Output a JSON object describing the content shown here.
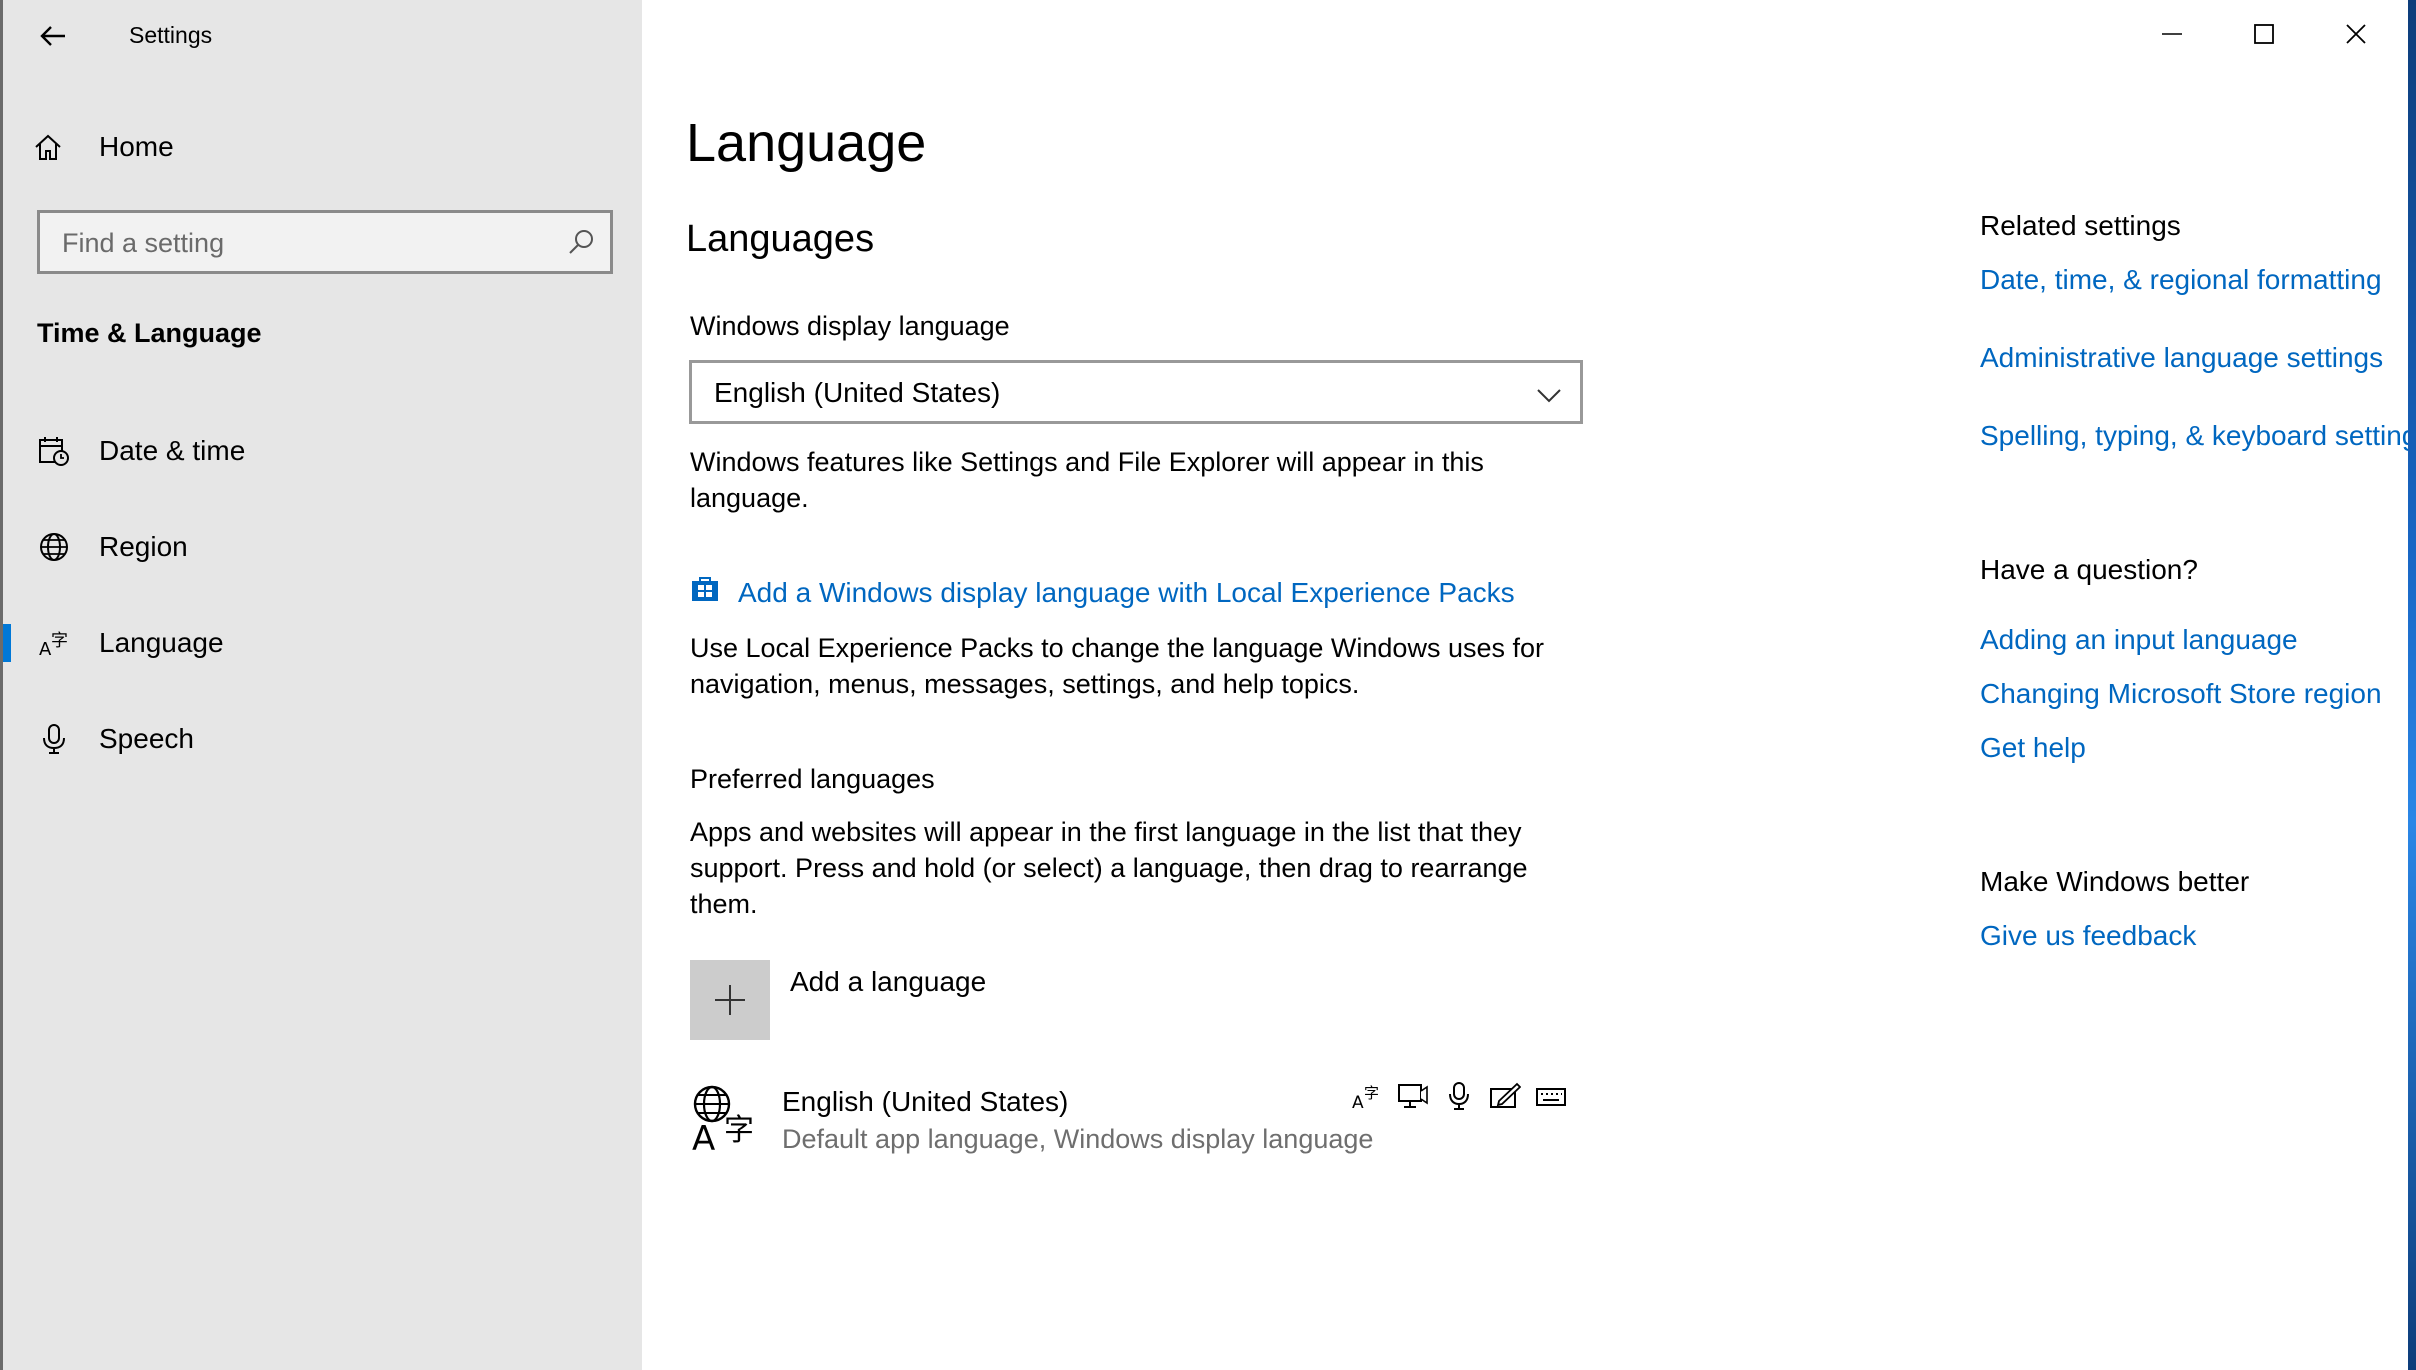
{
  "titlebar": {
    "app_title": "Settings",
    "back_icon": "back-arrow-icon",
    "controls": [
      "minimize-icon",
      "maximize-icon",
      "close-icon"
    ]
  },
  "sidebar": {
    "home_label": "Home",
    "search_placeholder": "Find a setting",
    "section_title": "Time & Language",
    "items": [
      {
        "label": "Date & time",
        "icon": "calendar-clock-icon",
        "active": false
      },
      {
        "label": "Region",
        "icon": "globe-icon",
        "active": false
      },
      {
        "label": "Language",
        "icon": "language-icon",
        "active": true
      },
      {
        "label": "Speech",
        "icon": "microphone-icon",
        "active": false
      }
    ]
  },
  "main": {
    "page_title": "Language",
    "section_title": "Languages",
    "display_language_label": "Windows display language",
    "display_language_value": "English (United States)",
    "display_language_desc": "Windows features like Settings and File Explorer will appear in this language.",
    "lxp_link": "Add a Windows display language with Local Experience Packs",
    "lxp_desc": "Use Local Experience Packs to change the language Windows uses for navigation, menus, messages, settings, and help topics.",
    "preferred_title": "Preferred languages",
    "preferred_desc": "Apps and websites will appear in the first language in the list that they support. Press and hold (or select) a language, then drag to rearrange them.",
    "add_language_label": "Add a language",
    "languages": [
      {
        "name": "English (United States)",
        "detail": "Default app language, Windows display language",
        "feature_icons": [
          "display-language-icon",
          "text-to-speech-icon",
          "speech-recognition-icon",
          "handwriting-icon",
          "keyboard-icon"
        ]
      }
    ]
  },
  "related": {
    "heading": "Related settings",
    "links": [
      "Date, time, & regional formatting",
      "Administrative language settings",
      "Spelling, typing, & keyboard settings"
    ]
  },
  "question": {
    "heading": "Have a question?",
    "links": [
      "Adding an input language",
      "Changing Microsoft Store region",
      "Get help"
    ]
  },
  "feedback": {
    "heading": "Make Windows better",
    "link": "Give us feedback"
  },
  "colors": {
    "accent": "#0078d7",
    "link": "#0067c0",
    "sidebar_bg": "#e6e6e6"
  }
}
